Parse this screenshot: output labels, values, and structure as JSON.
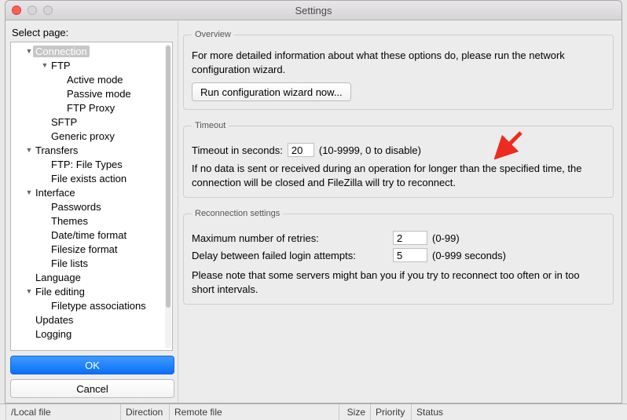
{
  "window": {
    "title": "Settings"
  },
  "sidebar": {
    "heading": "Select page:",
    "ok": "OK",
    "cancel": "Cancel",
    "tree": [
      {
        "label": "Connection",
        "indent": 0,
        "expanded": true,
        "selected": true
      },
      {
        "label": "FTP",
        "indent": 1,
        "expanded": true
      },
      {
        "label": "Active mode",
        "indent": 2
      },
      {
        "label": "Passive mode",
        "indent": 2
      },
      {
        "label": "FTP Proxy",
        "indent": 2
      },
      {
        "label": "SFTP",
        "indent": 1
      },
      {
        "label": "Generic proxy",
        "indent": 1
      },
      {
        "label": "Transfers",
        "indent": 0,
        "expanded": true
      },
      {
        "label": "FTP: File Types",
        "indent": 1
      },
      {
        "label": "File exists action",
        "indent": 1
      },
      {
        "label": "Interface",
        "indent": 0,
        "expanded": true
      },
      {
        "label": "Passwords",
        "indent": 1
      },
      {
        "label": "Themes",
        "indent": 1
      },
      {
        "label": "Date/time format",
        "indent": 1
      },
      {
        "label": "Filesize format",
        "indent": 1
      },
      {
        "label": "File lists",
        "indent": 1
      },
      {
        "label": "Language",
        "indent": 0
      },
      {
        "label": "File editing",
        "indent": 0,
        "expanded": true
      },
      {
        "label": "Filetype associations",
        "indent": 1
      },
      {
        "label": "Updates",
        "indent": 0
      },
      {
        "label": "Logging",
        "indent": 0
      }
    ]
  },
  "overview": {
    "legend": "Overview",
    "text": "For more detailed information about what these options do, please run the network configuration wizard.",
    "wizard_button": "Run configuration wizard now..."
  },
  "timeout": {
    "legend": "Timeout",
    "label": "Timeout in seconds:",
    "value": "20",
    "hint": "(10-9999, 0 to disable)",
    "description": "If no data is sent or received during an operation for longer than the specified time, the connection will be closed and FileZilla will try to reconnect."
  },
  "reconnect": {
    "legend": "Reconnection settings",
    "retries_label": "Maximum number of retries:",
    "retries_value": "2",
    "retries_hint": "(0-99)",
    "delay_label": "Delay between failed login attempts:",
    "delay_value": "5",
    "delay_hint": "(0-999 seconds)",
    "note": "Please note that some servers might ban you if you try to reconnect too often or in too short intervals."
  },
  "footer": {
    "col0": "/Local file",
    "col1": "Direction",
    "col2": "Remote file",
    "col3": "Size",
    "col4": "Priority",
    "col5": "Status"
  }
}
